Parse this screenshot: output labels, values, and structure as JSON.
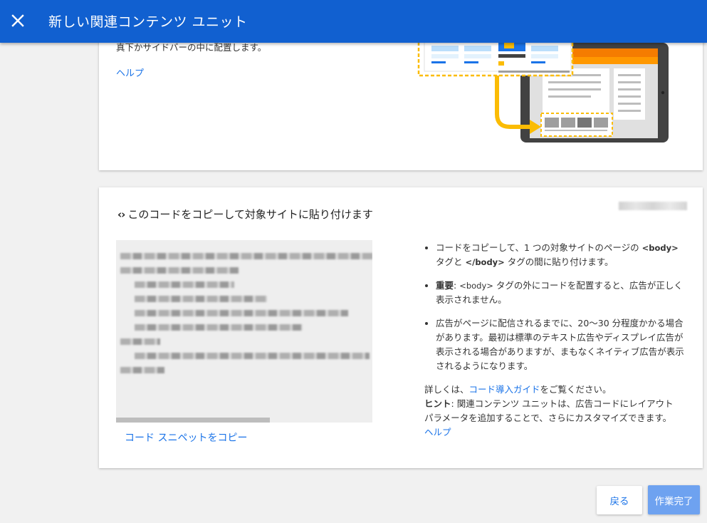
{
  "header": {
    "title": "新しい関連コンテンツ ユニット",
    "close_icon": "close-icon"
  },
  "placement_card": {
    "cut_text": "真下かサイドバーの中に配置します。",
    "help_link": "ヘルプ"
  },
  "code_card": {
    "title": "このコードをコピーして対象サイトに貼り付けます",
    "code_icon": "code-icon",
    "copy_link": "コード スニペットをコピー",
    "bullets": {
      "b1_pre": "コードをコピーして、1 つの対象サイトのページの ",
      "b1_tag1": "<body>",
      "b1_mid": " タグと ",
      "b1_tag2": "</body>",
      "b1_post": " タグの間に貼り付けます。",
      "b2_strong": "重要",
      "b2_pre": ": ",
      "b2_tag": "<body>",
      "b2_post": " タグの外にコードを配置すると、広告が正しく表示されません。",
      "b3": "広告がページに配信されるまでに、20〜30 分程度かかる場合があります。最初は標準のテキスト広告やディスプレイ広告が表示される場合がありますが、まもなくネイティブ広告が表示されるようになります。"
    },
    "details": {
      "pre": "詳しくは、",
      "link": "コード導入ガイド",
      "post": "をご覧ください。",
      "hint_label": "ヒント",
      "hint_text": ": 関連コンテンツ ユニットは、広告コードにレイアウト パラメータを追加することで、さらにカスタマイズできます。",
      "help_link": "ヘルプ"
    }
  },
  "footer": {
    "back_label": "戻る",
    "done_label": "作業完了"
  },
  "colors": {
    "header_bg": "#1160d0",
    "link": "#1a73e8",
    "accent_orange": "#ff9800",
    "accent_yellow": "#fbbc04"
  }
}
